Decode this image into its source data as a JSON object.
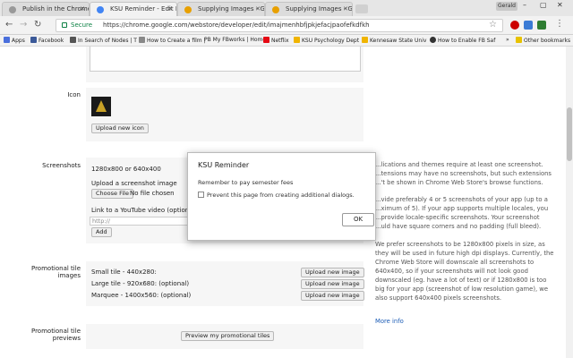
{
  "browser": {
    "tabs": [
      {
        "title": "Publish in the Chrome Web..."
      },
      {
        "title": "KSU Reminder - Edit Item"
      },
      {
        "title": "Supplying Images - Goo..."
      },
      {
        "title": "Supplying Images - Goo..."
      }
    ],
    "profile": "Gerald",
    "secure_label": "Secure",
    "url": "https://chrome.google.com/webstore/developer/edit/imajmenhbfjpkjefacjpaofefkdfkh"
  },
  "bookmarks": {
    "items": [
      {
        "label": "Apps"
      },
      {
        "label": "Facebook"
      },
      {
        "label": "In Search of Nodes | T"
      },
      {
        "label": "How to Create a film |"
      },
      {
        "label": "PB My FBworks | Home"
      },
      {
        "label": "Netflix"
      },
      {
        "label": "KSU Psychology Dept"
      },
      {
        "label": "Kennesaw State Univ"
      },
      {
        "label": "How to Enable FB Saf"
      }
    ],
    "other": "Other bookmarks",
    "overflow": "»"
  },
  "form": {
    "icon_label": "Icon",
    "upload_icon_button": "Upload new icon",
    "screenshots_label": "Screenshots",
    "screenshot_size": "1280x800 or 640x400",
    "upload_screenshot_label": "Upload a screenshot image",
    "choose_file_button": "Choose File",
    "no_file": "No file chosen",
    "youtube_label": "Link to a YouTube video (optional)",
    "youtube_placeholder": "http://",
    "add_button": "Add",
    "promo_label_line1": "Promotional tile",
    "promo_label_line2": "images",
    "small_tile": "Small tile - 440x280:",
    "large_tile": "Large tile - 920x680: (optional)",
    "marquee": "Marquee - 1400x560: (optional)",
    "upload_image_button": "Upload new image",
    "previews_label_line1": "Promotional tile",
    "previews_label_line2": "previews",
    "preview_button": "Preview my promotional tiles"
  },
  "help": {
    "para1": [
      "...lications and themes require at least one screenshot.",
      "...tensions may have no screenshots, but such extensions",
      "...'t be shown in Chrome Web Store's browse functions."
    ],
    "para2": [
      "...vide preferably 4 or 5 screenshots of your app (up to a",
      "...ximum of 5). If your app supports multiple locales, you",
      "...provide locale-specific screenshots. Your screenshot",
      "...uld have square corners and no padding (full bleed)."
    ],
    "para3": [
      "We prefer screenshots to be 1280x800 pixels in size, as",
      "they will be used in future high dpi displays. Currently, the",
      "Chrome Web Store will downscale all screenshots to",
      "640x400, so if your screenshots will not look good",
      "downscaled (eg. have a lot of text) or if 1280x800 is too",
      "big for your app (screenshot of low resolution game), we",
      "also support 640x400 pixels screenshots."
    ],
    "more_info": "More info"
  },
  "dialog": {
    "title": "KSU Reminder",
    "message": "Remember to pay semester fees",
    "checkbox_label": "Prevent this page from creating additional dialogs.",
    "ok": "OK"
  }
}
